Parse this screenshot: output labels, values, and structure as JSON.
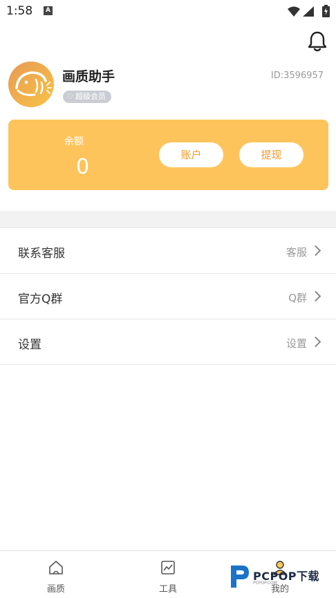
{
  "status_bar": {
    "time": "1:58",
    "a_icon": "A"
  },
  "profile": {
    "username": "画质助手",
    "vip_badge": "超级会员",
    "user_id": "ID:3596957"
  },
  "balance": {
    "label": "余额",
    "value": "0",
    "account_button": "账户",
    "withdraw_button": "提现"
  },
  "menu": {
    "items": [
      {
        "label": "联系客服",
        "value": "客服"
      },
      {
        "label": "官方Q群",
        "value": "Q群"
      },
      {
        "label": "设置",
        "value": "设置"
      }
    ]
  },
  "bottom_nav": {
    "items": [
      {
        "label": "画质",
        "icon": "home-icon"
      },
      {
        "label": "工具",
        "icon": "chart-icon"
      },
      {
        "label": "我的",
        "icon": "user-icon"
      }
    ]
  },
  "watermark": {
    "text": "PCPOP下载",
    "sub": "PCPOP.COM"
  },
  "colors": {
    "accent": "#fec45c",
    "button_text": "#f09a2a",
    "badge": "#c9cdd3"
  }
}
